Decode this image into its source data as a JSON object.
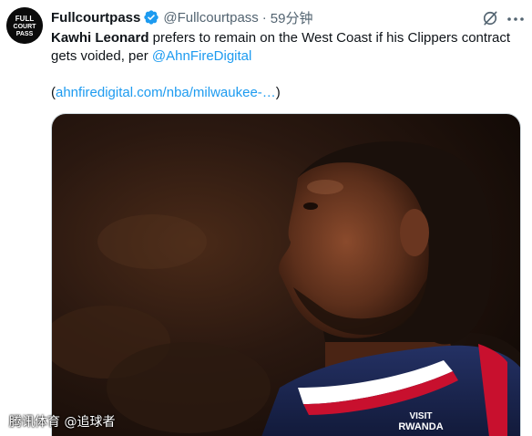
{
  "author": {
    "display_name": "Fullcourtpass",
    "handle": "@Fullcourtpass",
    "separator": "·",
    "time": "59分钟",
    "avatar_text": "FULL COURT PASS",
    "verified": true
  },
  "tweet": {
    "mention_name": "Kawhi Leonard",
    "body_text": " prefers to remain on the West Coast if his Clippers contract gets voided, per ",
    "source_mention": "@AhnFireDigital",
    "link_open": "(",
    "link_text": "ahnfiredigital.com/nba/milwaukee-…",
    "link_close": ")"
  },
  "media": {
    "jersey_text_1": "VISIT",
    "jersey_text_2": "RWANDA"
  },
  "watermark": "腾讯体育 @追球者",
  "icons": {
    "verified": "verified-badge-icon",
    "grok": "grok-icon",
    "more": "more-options-icon"
  },
  "colors": {
    "accent": "#1d9bf0",
    "secondary_text": "#536471",
    "jersey_navy": "#1b2650",
    "jersey_red": "#c8102e"
  }
}
